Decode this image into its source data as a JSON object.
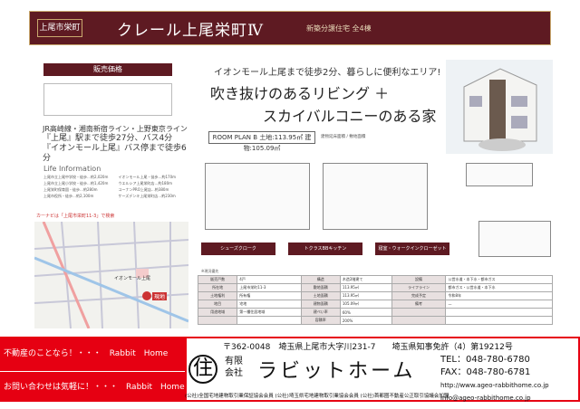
{
  "header": {
    "tag": "上尾市栄町",
    "title": "クレール上尾栄町Ⅳ",
    "subtitle": "新築分譲住宅 全4棟"
  },
  "price": {
    "heading": "販売価格"
  },
  "access": {
    "line1": "JR高崎線・湘南新宿ライン・上野東京ライン",
    "line2": "『上尾』駅まで徒歩27分、バス4分",
    "line3": "『イオンモール上尾』バス停まで徒歩6分"
  },
  "life": {
    "title": "Life Information",
    "items": [
      "上尾市立上尾中学校・徒歩…約2,020m",
      "上尾市立上尾小学校・徒歩…約1,420m",
      "上尾栄町保育園・徒歩…約280m",
      "上尾市役所・徒歩…約2,100m",
      "イオンモール上尾・徒歩…約170m",
      "ウエルシア上尾栄町店…約180m",
      "コーナンPRO上尾店…約380m",
      "ケーズデンキ上尾栄町店…約230m"
    ]
  },
  "map": {
    "label": "カーナビは「上尾市栄町11-3」で検索",
    "label_highlight": "上尾市栄町11-3",
    "site_marker": "現地",
    "store": "イオンモール上尾"
  },
  "catch": {
    "line1": "イオンモール上尾まで徒歩2分、暮らしに便利なエリア!",
    "line2": "吹き抜けのあるリビング ＋",
    "line3": "スカイバルコニーのある家"
  },
  "plan": {
    "label": "ROOM PLAN B",
    "land": "土地:113.95㎡",
    "building": "建物:105.09㎡",
    "meta": "建物延床面積 / 敷地面積"
  },
  "features": [
    "シューズクローク",
    "トクラスBBキッチン",
    "寝室・ウォークインクローゼット"
  ],
  "spec_note": "※現況優先",
  "spec": [
    [
      "販売戸数",
      "4戸",
      "構造",
      "木造2階建て",
      "設備",
      "公営水道・本下水・都市ガス"
    ],
    [
      "所在地",
      "上尾市栄町11-3",
      "敷地面積",
      "113.95㎡",
      "ライフライン",
      "都市ガス・公営水道・本下水"
    ],
    [
      "土地権利",
      "所有権",
      "土地面積",
      "113.95㎡",
      "完成予定",
      "令和8年"
    ],
    [
      "地目",
      "宅地",
      "建物面積",
      "105.09㎡",
      "備考",
      "—"
    ],
    [
      "用途地域",
      "第一種住居地域",
      "建ぺい率",
      "60%",
      "",
      ""
    ],
    [
      "",
      "",
      "容積率",
      "200%",
      "",
      ""
    ]
  ],
  "footer": {
    "left1": "不動産のことなら！・・・　Rabbit　Home",
    "left2": "お問い合わせは気軽に！・・・　Rabbit　Home",
    "address": "〒362-0048　埼玉県上尾市大字川231-7　　埼玉県知事免許（4）第19212号",
    "logo_char": "住",
    "yugen1": "有限",
    "yugen2": "会社",
    "company": "ラビットホーム",
    "tel_label": "TEL：",
    "tel": "048-780-6780",
    "fax_label": "FAX：",
    "fax": "048-780-6781",
    "url": "http://www.ageo-rabbithome.co.jp",
    "mail": "info@ageo-rabbithome.co.jp",
    "assoc": "(公社)全国宅地建物取引業保証協会会員 (公社)埼玉県宅地建物取引業協会会員 (公社)首都圏不動産公正取引協議会加盟"
  }
}
